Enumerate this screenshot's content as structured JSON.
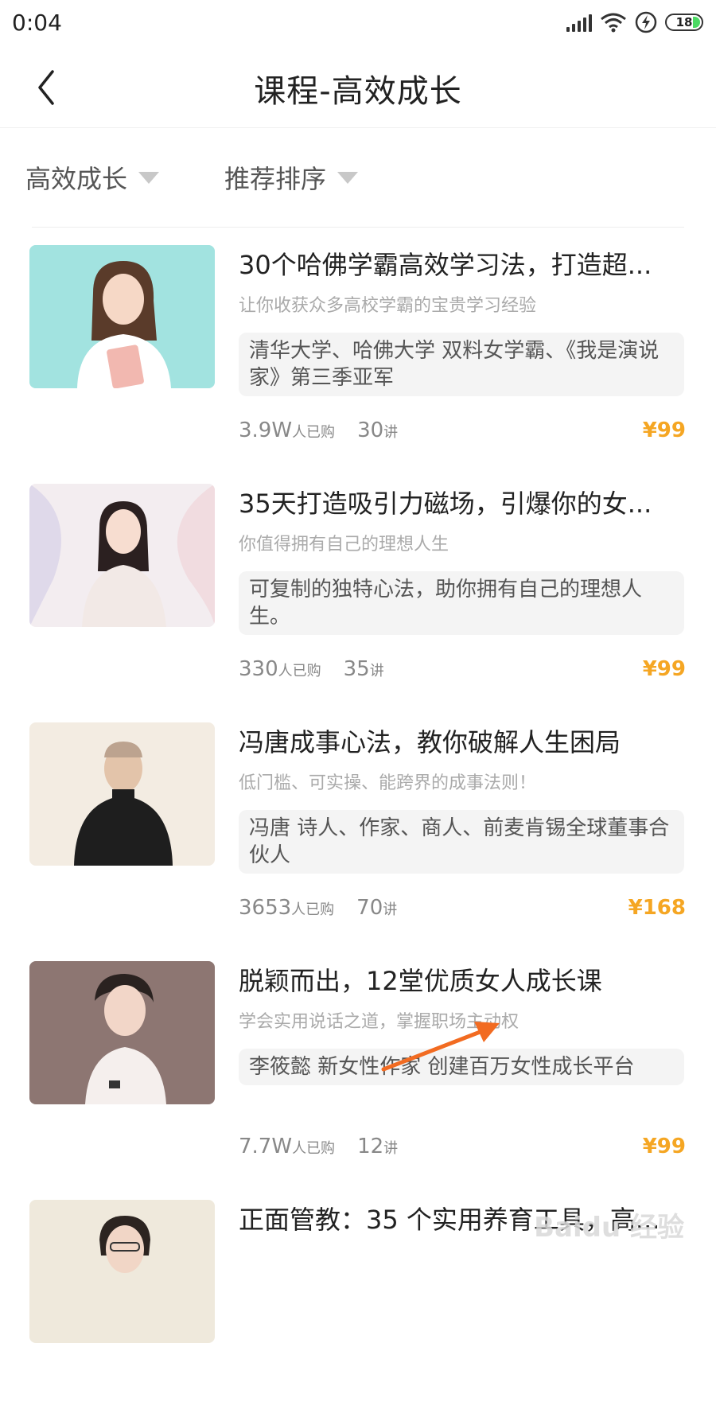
{
  "status_bar": {
    "time": "0:04",
    "battery_level": "18",
    "icons": [
      "signal-icon",
      "wifi-icon",
      "charging-icon",
      "battery-icon"
    ]
  },
  "header": {
    "title": "课程-高效成长",
    "back_icon": "chevron-left-icon"
  },
  "filters": [
    {
      "label": "高效成长",
      "icon": "dropdown-triangle-icon"
    },
    {
      "label": "推荐排序",
      "icon": "dropdown-triangle-icon"
    }
  ],
  "courses": [
    {
      "title": "30个哈佛学霸高效学习法，打造超...",
      "subtitle": "让你收获众多高校学霸的宝贵学习经验",
      "intro": "清华大学、哈佛大学 双料女学霸、《我是演说家》第三季亚军",
      "buyers": "3.9W",
      "buyers_unit": "人已购",
      "lectures": "30",
      "lectures_unit": "讲",
      "price": "¥99"
    },
    {
      "title": "35天打造吸引力磁场，引爆你的女...",
      "subtitle": "你值得拥有自己的理想人生",
      "intro": "可复制的独特心法，助你拥有自己的理想人生。",
      "buyers": "330",
      "buyers_unit": "人已购",
      "lectures": "35",
      "lectures_unit": "讲",
      "price": "¥99"
    },
    {
      "title": "冯唐成事心法，教你破解人生困局",
      "subtitle": "低门槛、可实操、能跨界的成事法则！",
      "intro": "冯唐 诗人、作家、商人、前麦肯锡全球董事合伙人",
      "buyers": "3653",
      "buyers_unit": "人已购",
      "lectures": "70",
      "lectures_unit": "讲",
      "price": "¥168"
    },
    {
      "title": "脱颖而出，12堂优质女人成长课",
      "subtitle": "学会实用说话之道，掌握职场主动权",
      "intro": "李筱懿 新女性作家  创建百万女性成长平台",
      "buyers": "7.7W",
      "buyers_unit": "人已购",
      "lectures": "12",
      "lectures_unit": "讲",
      "price": "¥99"
    },
    {
      "title": "正面管教：35 个实用养育工具，高...",
      "subtitle": "",
      "intro": "",
      "buyers": "",
      "buyers_unit": "",
      "lectures": "",
      "lectures_unit": "",
      "price": ""
    }
  ],
  "watermark": "Baidu 经验",
  "colors": {
    "price": "#f5a623",
    "annotation_arrow": "#f26b21"
  }
}
